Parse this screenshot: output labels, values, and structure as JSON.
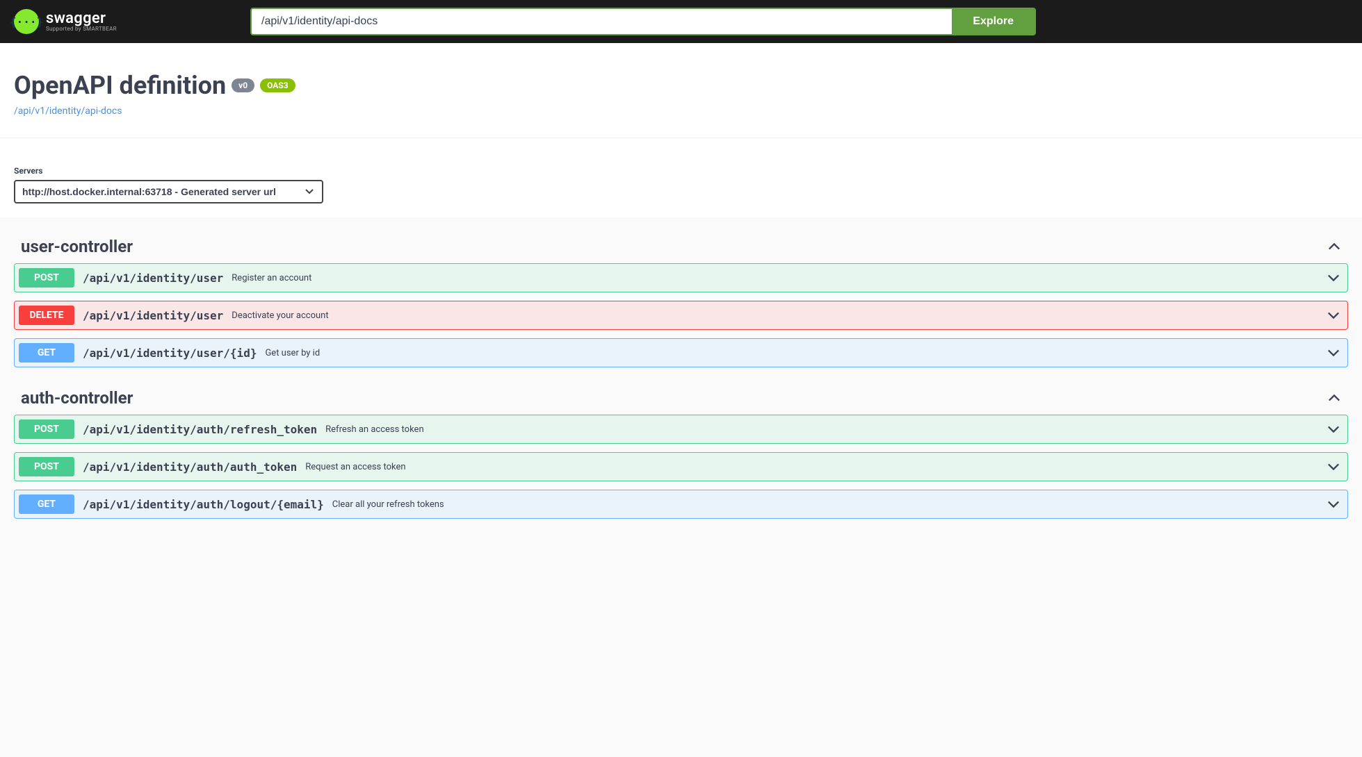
{
  "topbar": {
    "logo_glyph": "{···}",
    "logo_text": "swagger",
    "logo_sub": "Supported by SMARTBEAR",
    "url_value": "/api/v1/identity/api-docs",
    "explore_label": "Explore"
  },
  "info": {
    "title": "OpenAPI definition",
    "version_badge": "v0",
    "oas_badge": "OAS3",
    "spec_link": "/api/v1/identity/api-docs"
  },
  "servers": {
    "label": "Servers",
    "selected": "http://host.docker.internal:63718 - Generated server url"
  },
  "tags": [
    {
      "name": "user-controller",
      "ops": [
        {
          "method": "POST",
          "class": "post",
          "path": "/api/v1/identity/user",
          "desc": "Register an account"
        },
        {
          "method": "DELETE",
          "class": "delete",
          "path": "/api/v1/identity/user",
          "desc": "Deactivate your account"
        },
        {
          "method": "GET",
          "class": "get",
          "path": "/api/v1/identity/user/{id}",
          "desc": "Get user by id"
        }
      ]
    },
    {
      "name": "auth-controller",
      "ops": [
        {
          "method": "POST",
          "class": "post",
          "path": "/api/v1/identity/auth/refresh_token",
          "desc": "Refresh an access token"
        },
        {
          "method": "POST",
          "class": "post",
          "path": "/api/v1/identity/auth/auth_token",
          "desc": "Request an access token"
        },
        {
          "method": "GET",
          "class": "get",
          "path": "/api/v1/identity/auth/logout/{email}",
          "desc": "Clear all your refresh tokens"
        }
      ]
    }
  ]
}
